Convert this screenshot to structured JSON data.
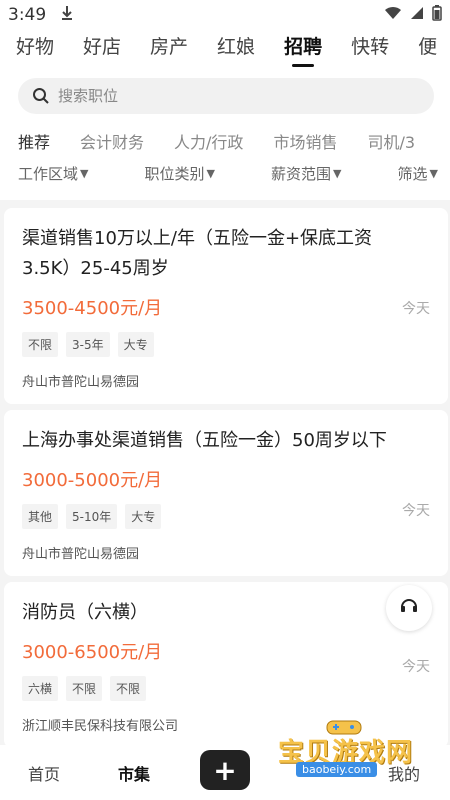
{
  "status": {
    "time": "3:49"
  },
  "top_categories": [
    "好物",
    "好店",
    "房产",
    "红娘",
    "招聘",
    "快转",
    "便"
  ],
  "search": {
    "placeholder": "搜索职位"
  },
  "job_categories": [
    "推荐",
    "会计财务",
    "人力/行政",
    "市场销售",
    "司机/3"
  ],
  "filters": [
    "工作区域",
    "职位类别",
    "薪资范围",
    "筛选"
  ],
  "jobs": [
    {
      "title": "渠道销售10万以上/年（五险一金+保底工资3.5K）25-45周岁",
      "salary": "3500-4500元/月",
      "tags": [
        "不限",
        "3-5年",
        "大专"
      ],
      "location": "舟山市普陀山易德园",
      "date": "今天"
    },
    {
      "title": "上海办事处渠道销售（五险一金）50周岁以下",
      "salary": "3000-5000元/月",
      "tags": [
        "其他",
        "5-10年",
        "大专"
      ],
      "location": "舟山市普陀山易德园",
      "date": "今天"
    },
    {
      "title": "消防员（六横）",
      "salary": "3000-6500元/月",
      "tags": [
        "六横",
        "不限",
        "不限"
      ],
      "location": "浙江顺丰民保科技有限公司",
      "date": "今天"
    }
  ],
  "bottom_nav": {
    "home": "首页",
    "market": "市集",
    "plus": "+",
    "mine": "我的"
  },
  "watermark": {
    "text": "宝贝游戏网",
    "url": "baobeiy.com"
  },
  "colors": {
    "accent_salary": "#f26b3a",
    "plus_button": "#222222"
  }
}
